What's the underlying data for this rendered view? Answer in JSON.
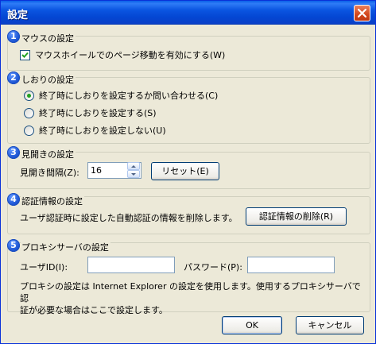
{
  "window": {
    "title": "設定"
  },
  "section1": {
    "number": "1",
    "title": "マウスの設定",
    "checkbox_label": "マウスホイールでのページ移動を有効にする(W)",
    "checked": true
  },
  "section2": {
    "number": "2",
    "title": "しおりの設定",
    "options": [
      {
        "label": "終了時にしおりを設定するか問い合わせる(C)",
        "selected": true
      },
      {
        "label": "終了時にしおりを設定する(S)",
        "selected": false
      },
      {
        "label": "終了時にしおりを設定しない(U)",
        "selected": false
      }
    ]
  },
  "section3": {
    "number": "3",
    "title": "見開きの設定",
    "interval_label": "見開き間隔(Z):",
    "interval_value": "16",
    "reset_label": "リセット(E)"
  },
  "section4": {
    "number": "4",
    "title": "認証情報の設定",
    "description": "ユーザ認証時に設定した自動認証の情報を削除します。",
    "delete_label": "認証情報の削除(R)"
  },
  "section5": {
    "number": "5",
    "title": "プロキシサーバの設定",
    "userid_label": "ユーザID(I):",
    "userid_value": "",
    "password_label": "パスワード(P):",
    "password_value": "",
    "note_line1": "プロキシの設定は Internet Explorer の設定を使用します。使用するプロキシサーバで認",
    "note_line2": "証が必要な場合はここで設定します。"
  },
  "buttons": {
    "ok": "OK",
    "cancel": "キャンセル"
  },
  "colors": {
    "titlebar": "#0a5fe8",
    "dialog_bg": "#ece9d8",
    "badge": "#1f58d6",
    "close": "#d2461b"
  },
  "icons": {
    "close": "close-icon",
    "check": "check-icon",
    "spin_up": "spin-up-icon",
    "spin_down": "spin-down-icon"
  }
}
